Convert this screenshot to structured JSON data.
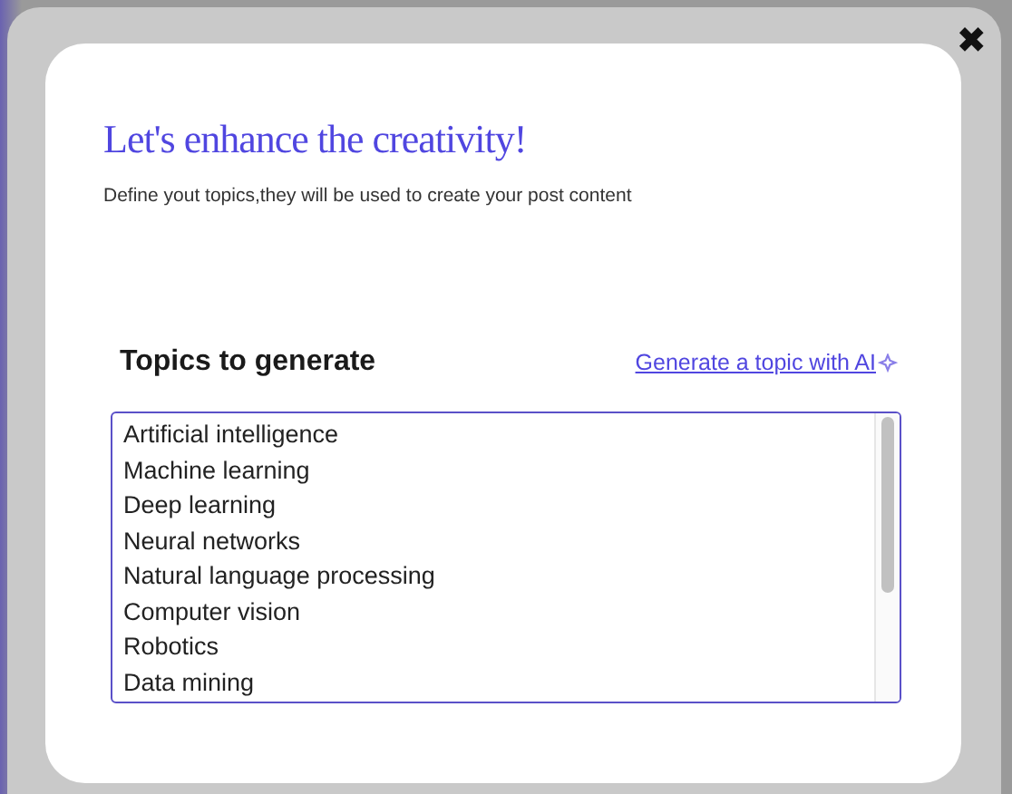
{
  "dialog": {
    "close": "✖",
    "title": "Let's enhance the creativity!",
    "subtitle": "Define yout topics,they will be used to create your post content",
    "section_title": "Topics to generate",
    "ai_link": "Generate a topic with AI",
    "topics": [
      "Artificial intelligence",
      "Machine learning",
      "Deep learning",
      "Neural networks",
      "Natural language processing",
      "Computer vision",
      "Robotics",
      "Data mining"
    ]
  }
}
